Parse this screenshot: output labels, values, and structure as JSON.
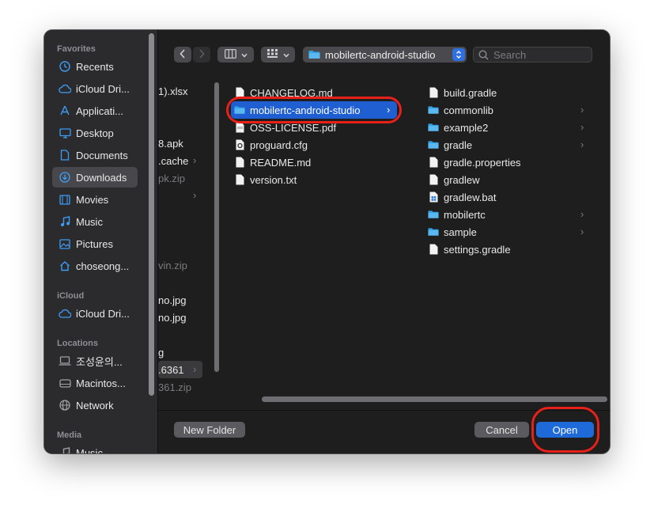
{
  "sidebar": {
    "favorites_header": "Favorites",
    "favorites": [
      {
        "label": "Recents",
        "icon": "clock-icon"
      },
      {
        "label": "iCloud Dri...",
        "icon": "cloud-icon"
      },
      {
        "label": "Applicati...",
        "icon": "applications-icon"
      },
      {
        "label": "Desktop",
        "icon": "desktop-icon"
      },
      {
        "label": "Documents",
        "icon": "document-icon"
      },
      {
        "label": "Downloads",
        "icon": "download-icon"
      },
      {
        "label": "Movies",
        "icon": "film-icon"
      },
      {
        "label": "Music",
        "icon": "music-icon"
      },
      {
        "label": "Pictures",
        "icon": "pictures-icon"
      },
      {
        "label": "choseong...",
        "icon": "home-icon"
      }
    ],
    "icloud_header": "iCloud",
    "icloud": [
      {
        "label": "iCloud Dri...",
        "icon": "cloud-icon"
      }
    ],
    "locations_header": "Locations",
    "locations": [
      {
        "label": "조성윤의...",
        "icon": "laptop-icon"
      },
      {
        "label": "Macintos...",
        "icon": "disk-icon"
      },
      {
        "label": "Network",
        "icon": "network-icon"
      }
    ],
    "media_header": "Media",
    "media": [
      {
        "label": "Music",
        "icon": "music-icon"
      }
    ]
  },
  "toolbar": {
    "path": "mobilertc-android-studio",
    "search_placeholder": "Search"
  },
  "column1": [
    {
      "text": "1).xlsx",
      "dim": false
    },
    {
      "text": "8.apk",
      "dim": false
    },
    {
      "text": ".cache",
      "dim": false
    },
    {
      "text": "pk.zip",
      "dim": true
    },
    {
      "text": "vin.zip",
      "dim": true
    },
    {
      "text": "no.jpg",
      "dim": false
    },
    {
      "text": "no.jpg",
      "dim": false
    },
    {
      "text": "g",
      "dim": false
    },
    {
      "text": ".6361",
      "dim": false
    },
    {
      "text": "361.zip",
      "dim": true
    }
  ],
  "column2": [
    {
      "name": "CHANGELOG.md",
      "kind": "doc"
    },
    {
      "name": "mobilertc-android-studio",
      "kind": "folder"
    },
    {
      "name": "OSS-LICENSE.pdf",
      "kind": "pdf"
    },
    {
      "name": "proguard.cfg",
      "kind": "cfg"
    },
    {
      "name": "README.md",
      "kind": "doc"
    },
    {
      "name": "version.txt",
      "kind": "doc"
    }
  ],
  "column3": [
    {
      "name": "build.gradle",
      "kind": "doc"
    },
    {
      "name": "commonlib",
      "kind": "folder"
    },
    {
      "name": "example2",
      "kind": "folder"
    },
    {
      "name": "gradle",
      "kind": "folder"
    },
    {
      "name": "gradle.properties",
      "kind": "doc"
    },
    {
      "name": "gradlew",
      "kind": "doc"
    },
    {
      "name": "gradlew.bat",
      "kind": "bat"
    },
    {
      "name": "mobilertc",
      "kind": "folder"
    },
    {
      "name": "sample",
      "kind": "folder"
    },
    {
      "name": "settings.gradle",
      "kind": "doc"
    }
  ],
  "buttons": {
    "new_folder": "New Folder",
    "cancel": "Cancel",
    "open": "Open"
  },
  "colors": {
    "accent": "#1f5fd1",
    "folder": "#34a3e8",
    "highlight": "#e8201a"
  }
}
